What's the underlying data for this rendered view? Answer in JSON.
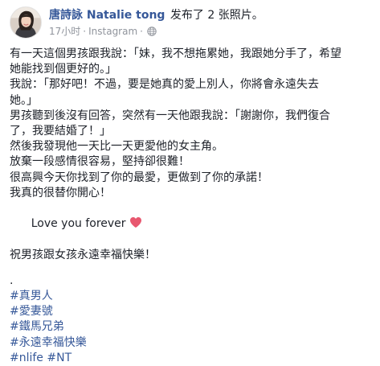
{
  "post": {
    "author": "唐詩詠 Natalie tong",
    "action": "发布了 2 张照片。",
    "time": "17小时",
    "separator": "·",
    "source": "Instagram",
    "privacy_icon": "globe-icon",
    "avatar": "profile-photo",
    "body_lines": [
      "有一天這個男孩跟我說：「妹，我不想拖累她，我跟她分手了，希望",
      "她能找到個更好的。」",
      "我說：「那好吧！不過，要是她真的愛上別人，你將會永遠失去",
      "她。」",
      "男孩聽到後沒有回答，突然有一天他跟我說：「謝謝你，我們復合",
      "了，我要結婚了！」",
      "然後我發現他一天比一天更愛他的女主角。",
      "放棄一段感情很容易，堅持卻很難！",
      "很高興今天你找到了你的最愛，更做到了你的承諾！",
      "我真的很替你開心！"
    ],
    "love_text": "Love you forever",
    "love_emoji": "heart-icon",
    "heart_color": "#e8576f",
    "blessing": "祝男孩跟女孩永遠幸福快樂！",
    "dot_line": ".",
    "hashtags": [
      "#真男人",
      "#愛妻號",
      "#鐵馬兄弟",
      "#永遠幸福快樂",
      "#nlife",
      "#NT"
    ],
    "link_color": "#365899"
  }
}
